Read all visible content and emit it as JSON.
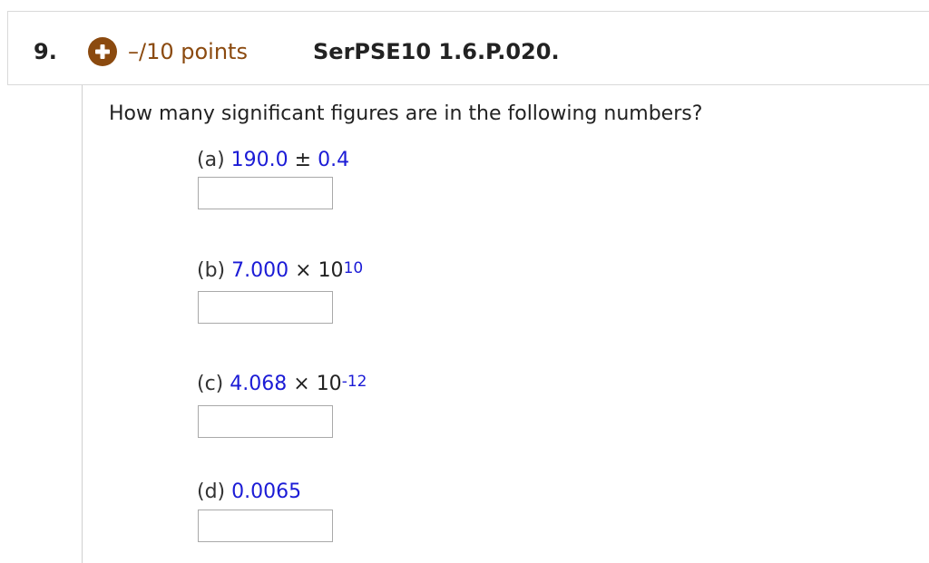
{
  "question": {
    "number": "9.",
    "points": "–/10 points",
    "id": "SerPSE10 1.6.P.020.",
    "prompt": "How many significant figures are in the following numbers?"
  },
  "parts": {
    "a": {
      "label": "(a)",
      "value": "190.0",
      "pm": "±",
      "uncertainty": "0.4",
      "answer": ""
    },
    "b": {
      "label": "(b)",
      "mantissa": "7.000",
      "times": "×",
      "base": "10",
      "exponent": "10",
      "answer": ""
    },
    "c": {
      "label": "(c)",
      "mantissa": "4.068",
      "times": "×",
      "base": "10",
      "exponent": "-12",
      "answer": ""
    },
    "d": {
      "label": "(d)",
      "value": "0.0065",
      "answer": ""
    }
  },
  "colors": {
    "points": "#8b4a0f",
    "plus_icon": "#8b4a0f",
    "given_value": "#1b1bd6"
  },
  "icons": {
    "expand": "plus-circle-icon"
  }
}
